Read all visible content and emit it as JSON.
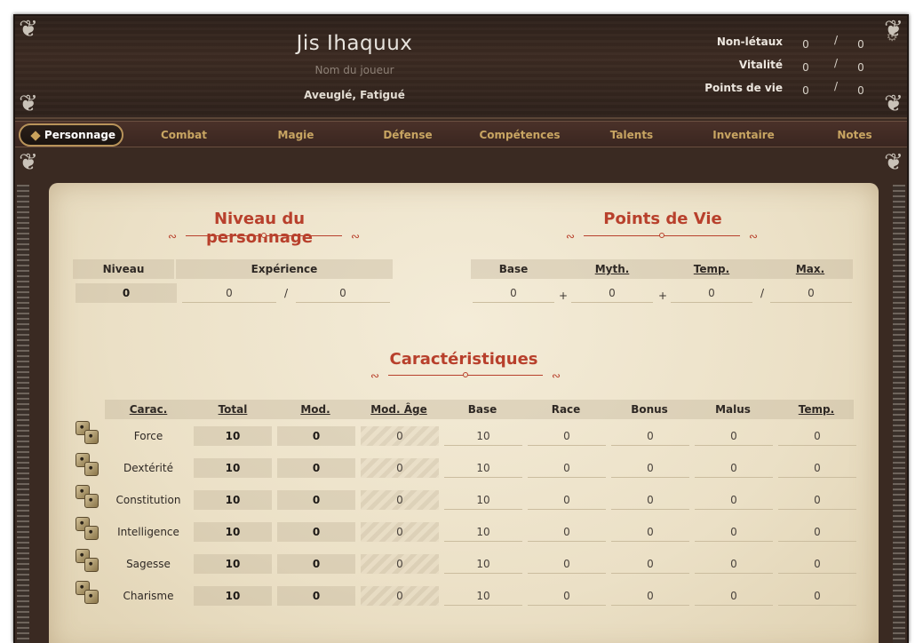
{
  "header": {
    "character_name": "Jis Ihaquux",
    "player_name_placeholder": "Nom du joueur",
    "conditions": "Aveuglé, Fatigué",
    "stats": [
      {
        "label": "Non-létaux",
        "current": "0",
        "sep": "/",
        "max": "0"
      },
      {
        "label": "Vitalité",
        "current": "0",
        "sep": "/",
        "max": "0"
      },
      {
        "label": "Points de vie",
        "current": "0",
        "sep": "/",
        "max": "0"
      }
    ],
    "settings_icon": "gear-icon"
  },
  "tabs": [
    "Personnage",
    "Combat",
    "Magie",
    "Défense",
    "Compétences",
    "Talents",
    "Inventaire",
    "Notes"
  ],
  "active_tab": "Personnage",
  "level_section": {
    "title": "Niveau du personnage",
    "headers": {
      "level": "Niveau",
      "experience": "Expérience"
    },
    "level": "0",
    "xp_current": "0",
    "xp_sep": "/",
    "xp_next": "0"
  },
  "hp_section": {
    "title": "Points de Vie",
    "headers": {
      "base": "Base",
      "myth": "Myth.",
      "temp": "Temp.",
      "max": "Max."
    },
    "base": "0",
    "op1": "+",
    "myth": "0",
    "op2": "+",
    "temp": "0",
    "op3": "/",
    "max": "0"
  },
  "abilities_section": {
    "title": "Caractéristiques",
    "headers": [
      "Carac.",
      "Total",
      "Mod.",
      "Mod. Âge",
      "Base",
      "Race",
      "Bonus",
      "Malus",
      "Temp."
    ],
    "rows": [
      {
        "name": "Force",
        "total": "10",
        "mod": "0",
        "age": "0",
        "base": "10",
        "race": "0",
        "bonus": "0",
        "malus": "0",
        "temp": "0"
      },
      {
        "name": "Dextérité",
        "total": "10",
        "mod": "0",
        "age": "0",
        "base": "10",
        "race": "0",
        "bonus": "0",
        "malus": "0",
        "temp": "0"
      },
      {
        "name": "Constitution",
        "total": "10",
        "mod": "0",
        "age": "0",
        "base": "10",
        "race": "0",
        "bonus": "0",
        "malus": "0",
        "temp": "0"
      },
      {
        "name": "Intelligence",
        "total": "10",
        "mod": "0",
        "age": "0",
        "base": "10",
        "race": "0",
        "bonus": "0",
        "malus": "0",
        "temp": "0"
      },
      {
        "name": "Sagesse",
        "total": "10",
        "mod": "0",
        "age": "0",
        "base": "10",
        "race": "0",
        "bonus": "0",
        "malus": "0",
        "temp": "0"
      },
      {
        "name": "Charisme",
        "total": "10",
        "mod": "0",
        "age": "0",
        "base": "10",
        "race": "0",
        "bonus": "0",
        "malus": "0",
        "temp": "0"
      }
    ]
  },
  "colors": {
    "accent_red": "#b8402c",
    "tab_gold": "#c8a562",
    "parchment": "#efe5cd",
    "wood": "#3a2a22"
  }
}
